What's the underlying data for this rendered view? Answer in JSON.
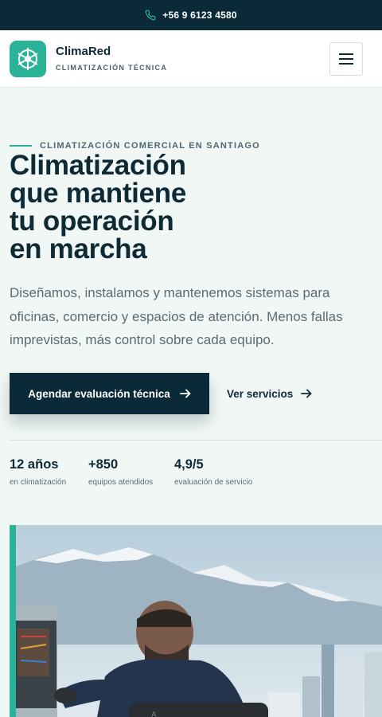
{
  "topbar": {
    "phone_icon": "phone-icon",
    "phone": "+56 9 6123 4580"
  },
  "brand": {
    "logo_icon": "snowflake-icon",
    "name": "ClimaRed",
    "tagline": "CLIMATIZACIÓN TÉCNICA"
  },
  "header": {
    "menu_icon": "hamburger-menu-icon"
  },
  "hero": {
    "eyebrow": "CLIMATIZACIÓN COMERCIAL EN SANTIAGO",
    "title_lines": [
      "Climatización",
      "que mantiene",
      "tu operación",
      "en marcha"
    ],
    "description": "Diseñamos, instalamos y mantenemos sistemas para oficinas, comercio y espacios de atención. Menos fallas imprevistas, más control sobre cada equipo.",
    "primary_cta": "Agendar evaluación técnica",
    "secondary_cta": "Ver servicios",
    "cta_icon": "arrow-right-icon"
  },
  "stats": [
    {
      "value": "12 años",
      "label": "en climatización"
    },
    {
      "value": "+850",
      "label": "equipos atendidos"
    },
    {
      "value": "4,9/5",
      "label": "evaluación de servicio"
    }
  ],
  "colors": {
    "dark_navy": "#0b2a37",
    "accent_teal": "#2bb39a",
    "background": "#f1f7f5",
    "text_muted": "#5a6b71"
  }
}
